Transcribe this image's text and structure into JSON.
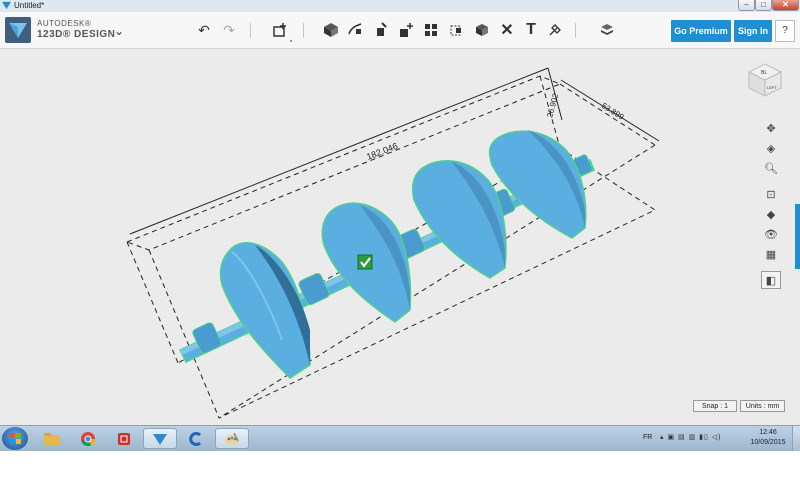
{
  "window": {
    "title": "Untitled*",
    "controls": {
      "minimize": "–",
      "maximize": "□",
      "close": "✕"
    }
  },
  "brand": {
    "line1": "AUTODESK®",
    "line2": "123D® DESIGN"
  },
  "toolbar": {
    "menu_icon": "chevron-down-icon",
    "undo": "↶",
    "redo": "↷",
    "tools": [
      "primitives-icon",
      "sketch-icon",
      "construct-icon",
      "modify-icon",
      "pattern-icon",
      "group-icon",
      "combine-icon",
      "measure-icon",
      "text-icon",
      "snap-icon",
      "material-icon"
    ],
    "premium_label": "Go Premium",
    "signin_label": "Sign In",
    "help_label": "?"
  },
  "viewport": {
    "dimensions": {
      "length": "182.046",
      "width": "53.899",
      "height": "26.902"
    },
    "viewcube": {
      "face_top": "BL",
      "face_left": "LEFT"
    },
    "snap_label": "Snap : 1",
    "units_label": "Units : mm",
    "selection_color": "#4fd18b",
    "model_color": "#58aee0",
    "accent": "#1f8fd1"
  },
  "right_toolbar": [
    "pan-icon",
    "orbit-icon",
    "zoom-icon",
    "fit-icon",
    "view-icon",
    "visibility-icon",
    "grid-icon",
    "material-icon"
  ],
  "taskbar": {
    "apps": [
      "start-button",
      "explorer-icon",
      "chrome-icon",
      "sketchup-icon",
      "123d-design-icon",
      "ccleaner-icon",
      "paint-icon"
    ],
    "language": "FR",
    "time": "12:46",
    "date": "10/09/2015"
  }
}
